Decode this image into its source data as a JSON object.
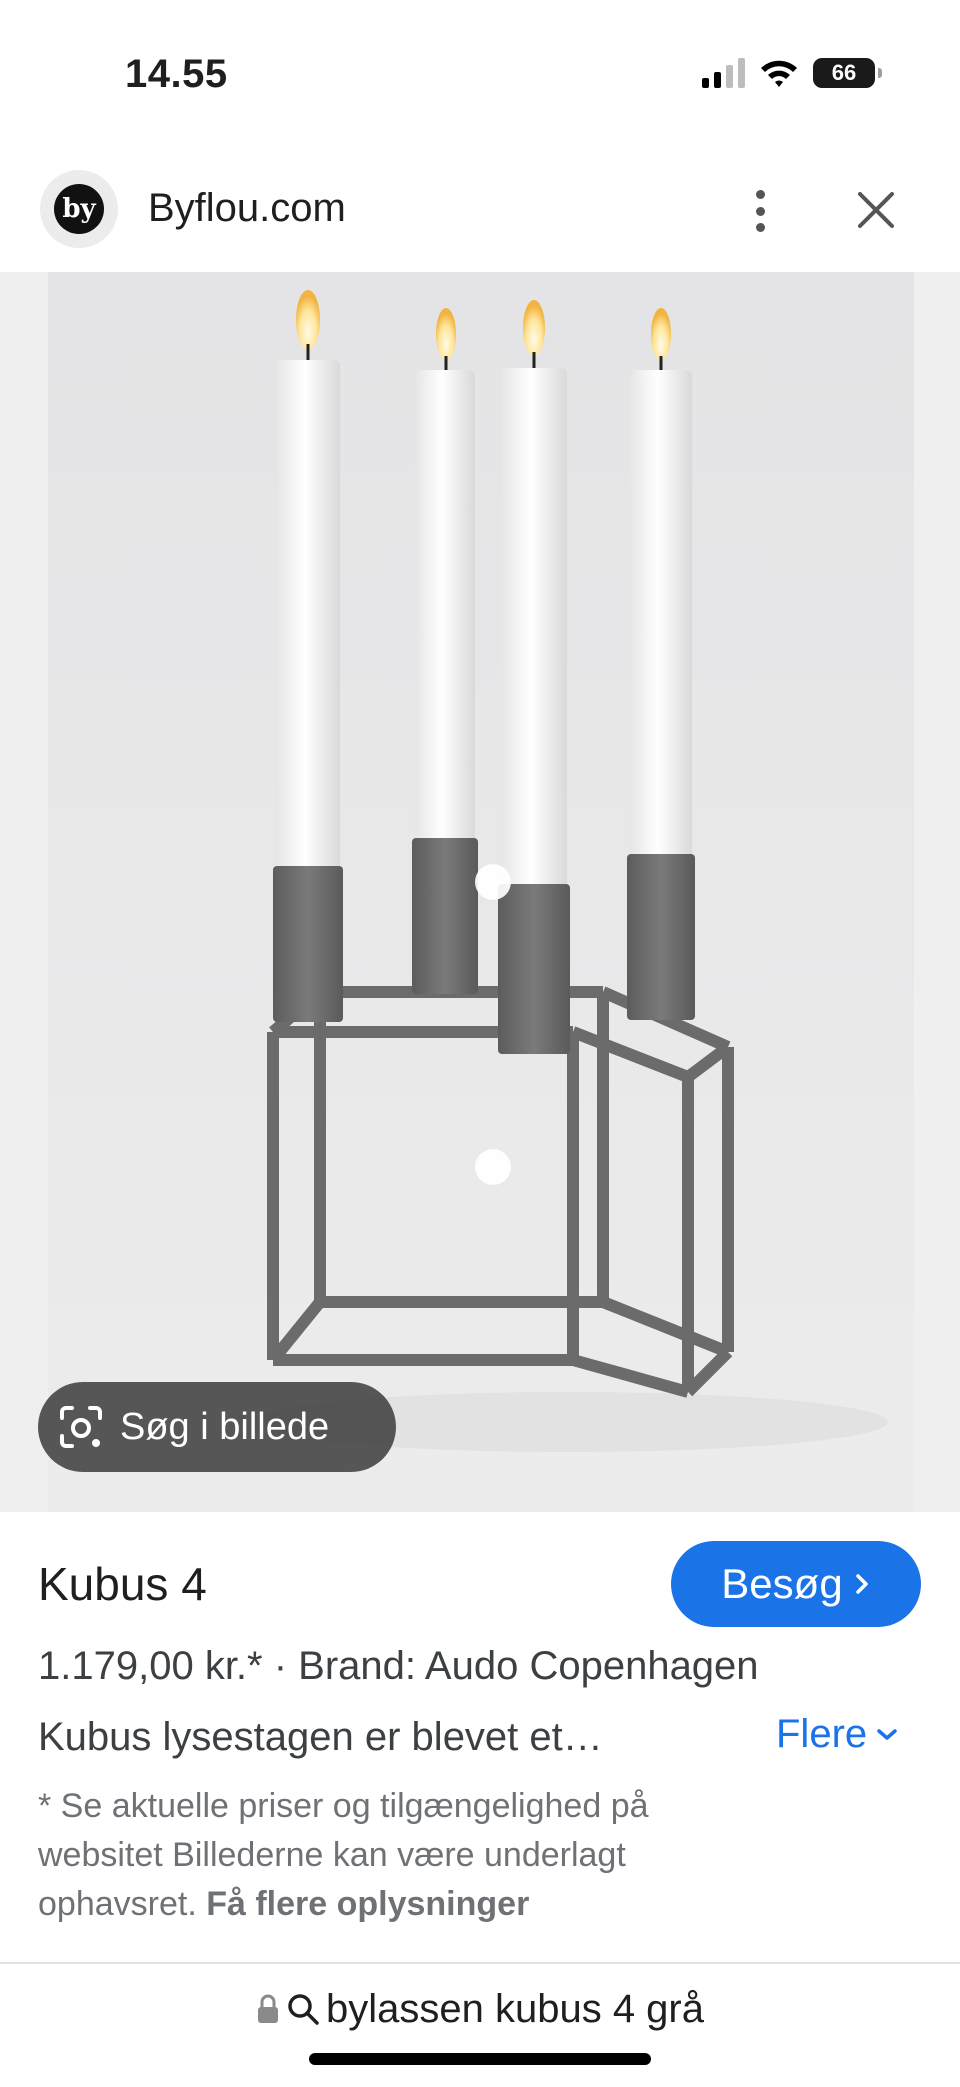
{
  "status_bar": {
    "time": "14.55",
    "battery": "66",
    "icons": [
      "signal-icon",
      "wifi-icon",
      "battery-icon"
    ]
  },
  "site": {
    "logo_text": "by",
    "name": "Byflou.com",
    "icons": [
      "more-vert-icon",
      "close-icon"
    ]
  },
  "image": {
    "search_label": "Søg i billede",
    "icon": "lens-icon"
  },
  "product": {
    "title": "Kubus 4",
    "visit_label": "Besøg",
    "price_line": "1.179,00 kr.* · Brand: Audo Copenhagen",
    "description": "Kubus lysestagen er blevet et…",
    "more_label": "Flere",
    "disclaimer": "* Se aktuelle priser og tilgængelighed på websitet Billederne kan være underlagt ophavsret.",
    "info_link": "Få flere oplysninger"
  },
  "address_bar": {
    "query": "bylassen kubus 4 grå",
    "icons": [
      "lock-icon",
      "search-icon"
    ]
  },
  "colors": {
    "accent": "#1b73e8",
    "image_bg": "#efefef",
    "frame_grey": "#6b6b6b"
  }
}
